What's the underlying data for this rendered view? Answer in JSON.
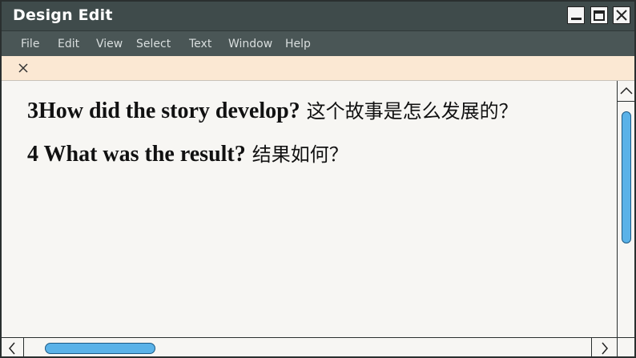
{
  "window": {
    "title": "Design Edit",
    "accent_color": "#5ab2e8",
    "titlebar_color": "#3f4b4b",
    "tabbar_color": "#fbe8d3"
  },
  "menu": {
    "items": [
      "File",
      "Edit",
      "View",
      "Select",
      "Text",
      "Window",
      "Help"
    ]
  },
  "document": {
    "lines": [
      {
        "english": "3How did the story develop?",
        "chinese": "这个故事是怎么发展的？"
      },
      {
        "english": "4 What was the result?",
        "chinese": "结果如何？"
      }
    ]
  },
  "icons": {
    "minimize": "minimize-icon",
    "maximize": "maximize-icon",
    "close": "close-icon",
    "tab_close": "close-icon",
    "scroll_up": "chevron-up-icon",
    "scroll_left": "chevron-left-icon",
    "scroll_right": "chevron-right-icon"
  }
}
